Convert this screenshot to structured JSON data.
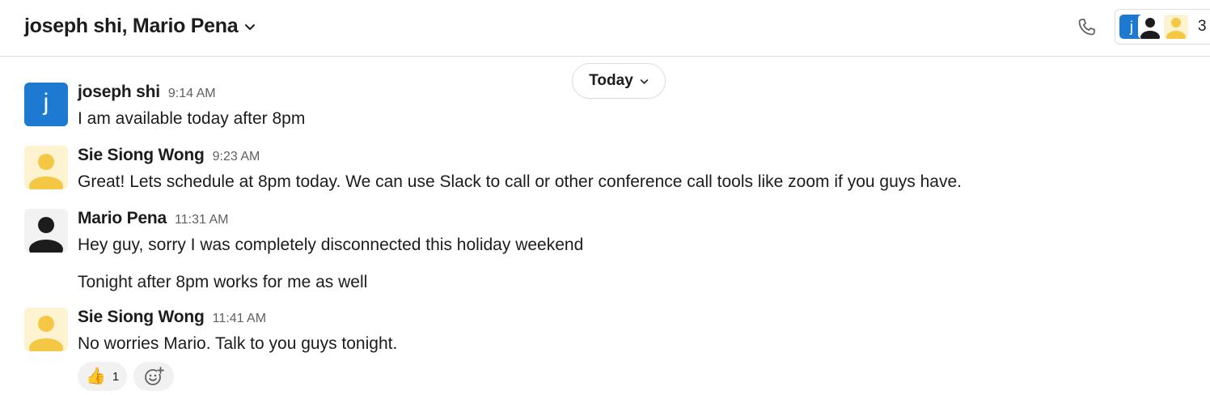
{
  "header": {
    "title": "joseph shi, Mario Pena",
    "call_icon": "phone-icon",
    "members": {
      "count": "3",
      "avatars": [
        {
          "type": "letter",
          "letter": "j",
          "color": "#1d7ad0"
        },
        {
          "type": "silhouette",
          "color": "#1d1c1d"
        },
        {
          "type": "silhouette",
          "color": "#f4c744"
        }
      ]
    }
  },
  "date_divider": {
    "label": "Today"
  },
  "messages": [
    {
      "author": "joseph shi",
      "time": "9:14 AM",
      "avatar": {
        "letter": "j",
        "color": "#1d7ad0"
      },
      "lines": [
        "I am available today after 8pm"
      ]
    },
    {
      "author": "Sie Siong Wong",
      "time": "9:23 AM",
      "avatar": {
        "color": "#f4c744"
      },
      "lines": [
        "Great! Lets schedule at 8pm today. We can use Slack to call or other conference call tools like zoom if you guys have."
      ]
    },
    {
      "author": "Mario Pena",
      "time": "11:31 AM",
      "avatar": {
        "color": "#1d1c1d"
      },
      "lines": [
        "Hey guy, sorry I was completely disconnected this holiday weekend",
        "Tonight after 8pm works for me as well"
      ]
    },
    {
      "author": "Sie Siong Wong",
      "time": "11:41 AM",
      "avatar": {
        "color": "#f4c744"
      },
      "lines": [
        "No worries Mario. Talk to you guys tonight."
      ]
    }
  ],
  "reactions": [
    {
      "emoji": "👍",
      "icon": "thumbs-up-icon",
      "count": "1"
    }
  ],
  "add_reaction_icon": "add-emoji-icon",
  "colors": {
    "accent_blue": "#1d7ad0",
    "text": "#1d1c1d",
    "muted": "#616061",
    "border": "#dddddd"
  }
}
